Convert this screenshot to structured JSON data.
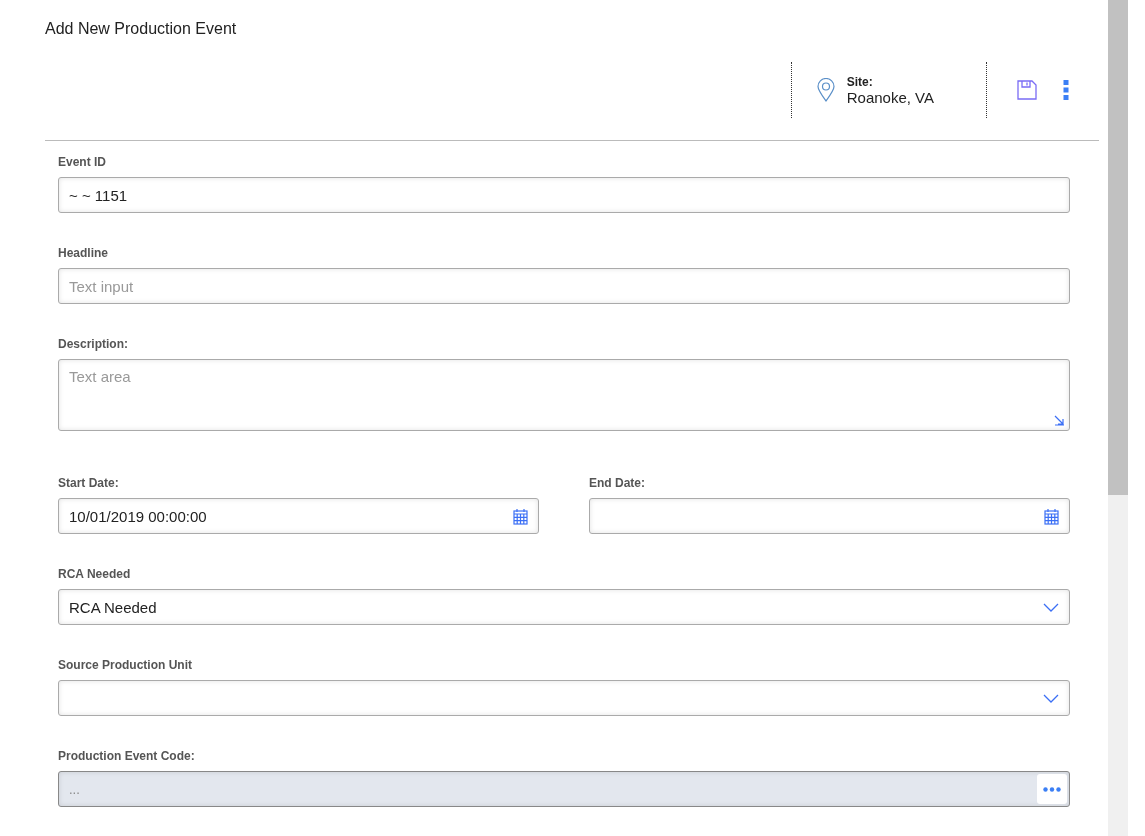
{
  "title": "Add New Production Event",
  "header": {
    "site_label": "Site:",
    "site_value": "Roanoke, VA"
  },
  "rows": [
    {
      "kind": "text",
      "label": "Event ID",
      "value": "~ ~ 1151"
    },
    {
      "kind": "text",
      "label": "Headline",
      "placeholder": "Text input"
    },
    {
      "kind": "textarea",
      "label": "Description:",
      "placeholder": "Text area"
    },
    {
      "kind": "dates",
      "items": [
        {
          "label": "Start Date:",
          "value": "10/01/2019 00:00:00"
        },
        {
          "label": "End Date:"
        }
      ]
    },
    {
      "kind": "select",
      "label": "RCA Needed",
      "value": "RCA Needed"
    },
    {
      "kind": "select",
      "label": "Source Production Unit"
    },
    {
      "kind": "lookup",
      "label": "Production Event Code:",
      "placeholder": "...",
      "disabled": true
    }
  ]
}
